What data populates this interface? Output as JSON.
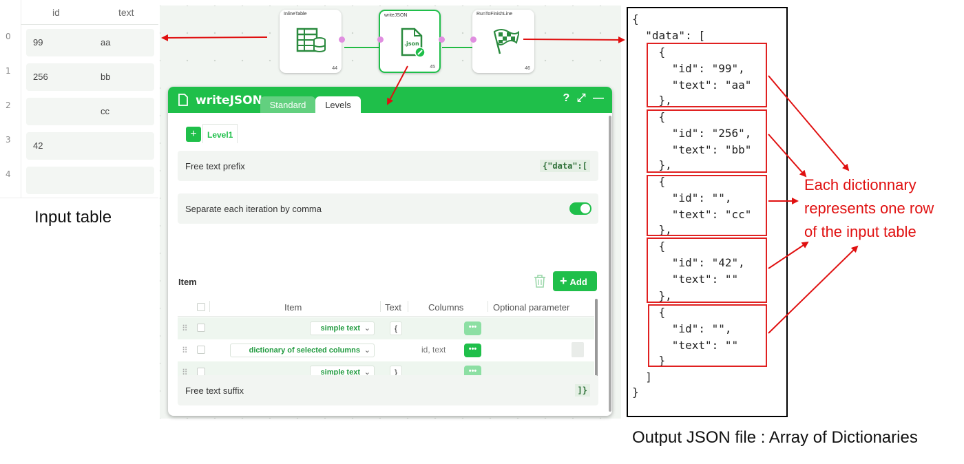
{
  "input_table": {
    "columns": [
      "id",
      "text"
    ],
    "rows": [
      {
        "index": "0",
        "id": "99",
        "text": "aa"
      },
      {
        "index": "1",
        "id": "256",
        "text": "bb"
      },
      {
        "index": "2",
        "id": "",
        "text": "cc"
      },
      {
        "index": "3",
        "id": "42",
        "text": ""
      },
      {
        "index": "4",
        "id": "",
        "text": ""
      }
    ],
    "caption": "Input table"
  },
  "workflow": {
    "nodes": [
      {
        "title": "InlineTable",
        "number": "44",
        "icon": "table-database-icon"
      },
      {
        "title": "writeJSON",
        "number": "45",
        "icon": "json-file-icon"
      },
      {
        "title": "RunToFinishLine",
        "number": "46",
        "icon": "checkered-flag-icon"
      }
    ]
  },
  "panel": {
    "title": "writeJSON",
    "tabs": [
      "Standard",
      "Levels"
    ],
    "active_tab": "Levels",
    "level_tab": "Level1",
    "free_text_prefix_label": "Free text prefix",
    "free_text_prefix_value": "{\"data\":[",
    "separate_label": "Separate each iteration by comma",
    "separate_enabled": true,
    "item_label": "Item",
    "add_label": "Add",
    "grid_headers": [
      "Item",
      "Text",
      "Columns",
      "Optional parameter"
    ],
    "grid_rows": [
      {
        "item": "simple text",
        "text": "{",
        "columns": ""
      },
      {
        "item": "dictionary of selected columns",
        "text": "",
        "columns": "id, text"
      },
      {
        "item": "simple text",
        "text": "}",
        "columns": ""
      }
    ],
    "free_text_suffix_label": "Free text suffix",
    "free_text_suffix_value": "]}"
  },
  "json_output": {
    "lines": [
      "{",
      "  \"data\": [",
      "    {",
      "      \"id\": \"99\",",
      "      \"text\": \"aa\"",
      "    },",
      "    {",
      "      \"id\": \"256\",",
      "      \"text\": \"bb\"",
      "    },",
      "    {",
      "      \"id\": \"\",",
      "      \"text\": \"cc\"",
      "    },",
      "    {",
      "      \"id\": \"42\",",
      "      \"text\": \"\"",
      "    },",
      "    {",
      "      \"id\": \"\",",
      "      \"text\": \"\"",
      "    }",
      "  ]",
      "}"
    ],
    "caption": "Output JSON file : Array of Dictionaries"
  },
  "annotation": {
    "lines": [
      "Each dictionnary",
      "represents one row",
      "of the input table"
    ],
    "color": "#e01010"
  },
  "colors": {
    "accent": "#1fbf4a",
    "canvas": "#f1f5f1",
    "port": "#e08ee0"
  }
}
